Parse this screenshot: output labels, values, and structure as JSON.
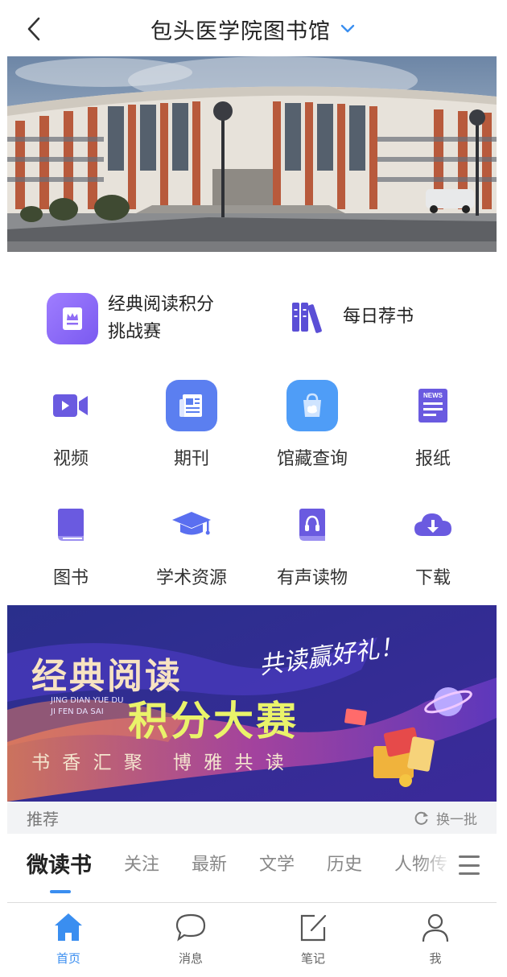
{
  "header": {
    "title": "包头医学院图书馆",
    "back_icon": "chevron-left-icon",
    "dropdown_icon": "chevron-down-icon",
    "accent": "#3a8ef0"
  },
  "featured": [
    {
      "label_line1": "经典阅读积分",
      "label_line2": "挑战赛",
      "icon": "crown-book-icon",
      "color": "#8f6cf5"
    },
    {
      "label": "每日荐书",
      "icon": "bookshelf-icon",
      "color": "#5b4fd6"
    }
  ],
  "grid": [
    {
      "label": "视频",
      "icon": "video-camera-icon",
      "color": "#6a5ae0"
    },
    {
      "label": "期刊",
      "icon": "journal-icon",
      "color": "#5b7ff0"
    },
    {
      "label": "馆藏查询",
      "icon": "shopping-bag-icon",
      "color": "#4f9df7"
    },
    {
      "label": "报纸",
      "icon": "newspaper-icon",
      "color": "#6a5ae0",
      "badge": "NEWS"
    },
    {
      "label": "图书",
      "icon": "book-icon",
      "color": "#6a5ae0"
    },
    {
      "label": "学术资源",
      "icon": "graduation-cap-icon",
      "color": "#5a6ff0"
    },
    {
      "label": "有声读物",
      "icon": "audiobook-icon",
      "color": "#6a5ae0"
    },
    {
      "label": "下载",
      "icon": "cloud-download-icon",
      "color": "#6a5ae0"
    }
  ],
  "promo": {
    "title_line1": "经典阅读",
    "pinyin_line1": "JING DIAN YUE DU",
    "pinyin_line2": "JI FEN DA SAI",
    "title_line2": "积分大赛",
    "slogan": "共读赢好礼！",
    "subtitle": "书 香 汇 聚   博 雅 共 读"
  },
  "recommend": {
    "title": "推荐",
    "refresh_label": "换一批",
    "refresh_icon": "refresh-icon"
  },
  "tabs": [
    {
      "label": "微读书",
      "active": true
    },
    {
      "label": "关注"
    },
    {
      "label": "最新"
    },
    {
      "label": "文学"
    },
    {
      "label": "历史"
    },
    {
      "label": "人物传"
    }
  ],
  "menu_icon": "hamburger-menu-icon",
  "bottom_nav": [
    {
      "label": "首页",
      "icon": "home-icon",
      "active": true
    },
    {
      "label": "消息",
      "icon": "chat-bubble-icon"
    },
    {
      "label": "笔记",
      "icon": "edit-note-icon"
    },
    {
      "label": "我",
      "icon": "user-icon"
    }
  ]
}
